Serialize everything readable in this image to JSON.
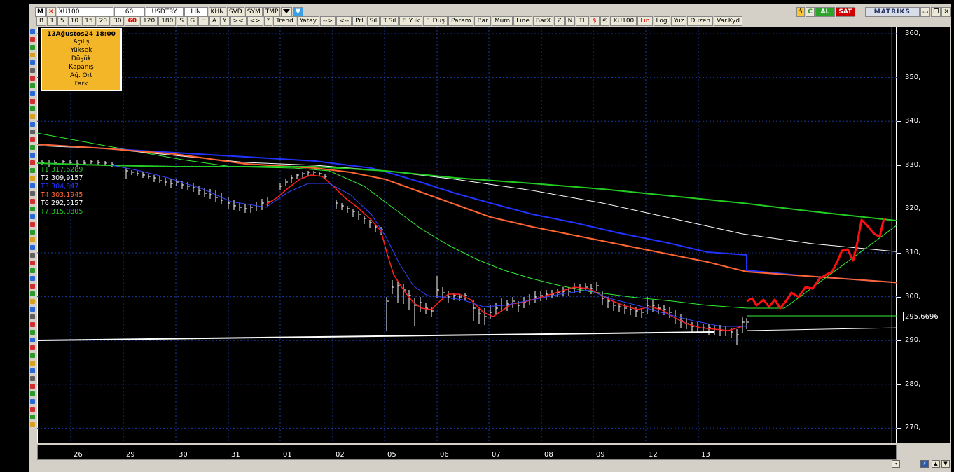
{
  "toolbar1": {
    "logo": "M",
    "symbol": "XU100",
    "period": "60",
    "currency": "USDTRY",
    "scale": "LIN",
    "buttons": [
      "KHN",
      "SVD",
      "SYM",
      "TMP"
    ],
    "al": "AL",
    "sat": "SAT",
    "brand": "MATRIKS"
  },
  "toolbar2": {
    "items": [
      "B",
      "1",
      "5",
      "10",
      "15",
      "20",
      "30",
      "60",
      "120",
      "180",
      "S",
      "G",
      "H",
      "A",
      "Y",
      "><",
      "<>",
      "*",
      "Trend",
      "Yatay",
      "-->",
      "<--",
      "Prl",
      "Sil",
      "T.Sil",
      "F. Yük",
      "F. Düş",
      "Param",
      "Bar",
      "Mum",
      "Line",
      "BarX",
      "Z",
      "N",
      "TL",
      "$",
      "€",
      "XU100",
      "Lin",
      "Log",
      "Yüz",
      "Düzen",
      "Var.Kyd"
    ],
    "active": "60"
  },
  "infobox": {
    "date": "13Ağustos24 18:00",
    "rows": [
      "Açılış",
      "Yüksek",
      "Düşük",
      "Kapanış",
      "Ağ. Ort",
      "Fark"
    ]
  },
  "trend_labels": [
    {
      "text": "T1:317,6289",
      "color": "#22cc22"
    },
    {
      "text": "T2:309,9157",
      "color": "#ffffff"
    },
    {
      "text": "T3:304,847",
      "color": "#2233ff"
    },
    {
      "text": "T4:303,1945",
      "color": "#ff6633"
    },
    {
      "text": "T6:292,5157",
      "color": "#ffffff"
    },
    {
      "text": "T7:315,0805",
      "color": "#22cc22"
    }
  ],
  "y_axis": [
    "360,",
    "350,",
    "340,",
    "330,",
    "320,",
    "310,",
    "300,",
    "290,",
    "280,",
    "270,"
  ],
  "x_axis": [
    "26",
    "29",
    "30",
    "31",
    "01",
    "02",
    "05",
    "06",
    "07",
    "08",
    "09",
    "12",
    "13"
  ],
  "last_price": "295,6696",
  "colors": {
    "ma_red": "#ff2020",
    "ma_blue": "#2233ff",
    "ma_orange": "#ff6633",
    "ma_green": "#22cc22",
    "ma_white": "#ffffff",
    "ma_thin_green": "#33ee33",
    "plot_bg": "#000000",
    "panel": "#d4d0c8",
    "info_bg": "#f3b628"
  }
}
